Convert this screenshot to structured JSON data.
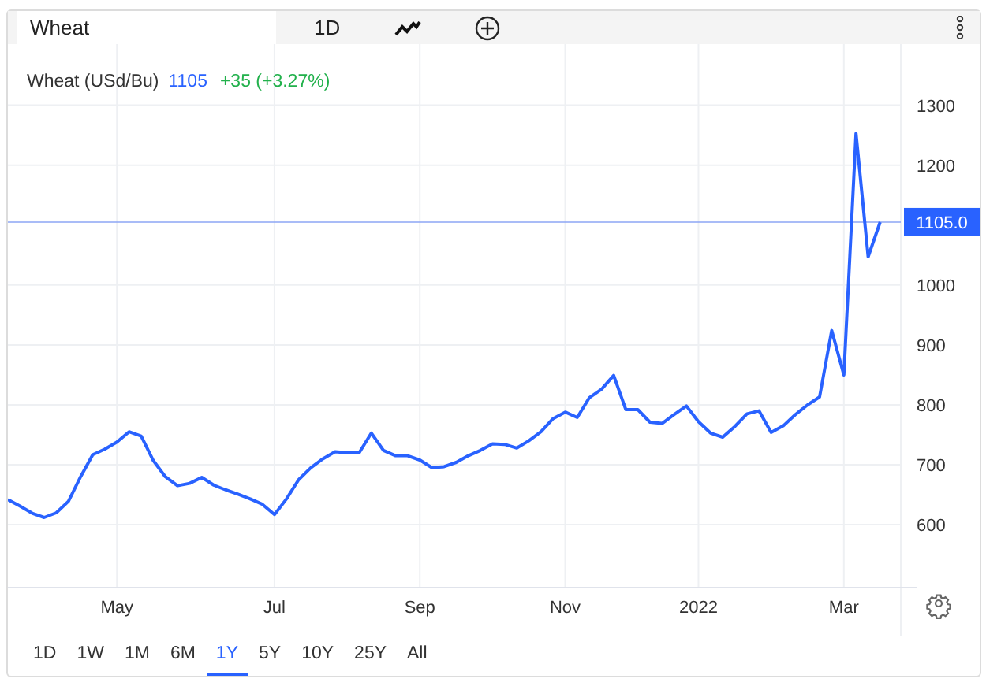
{
  "toolbar": {
    "search": {
      "value": "Wheat"
    },
    "interval": "1D"
  },
  "legend": {
    "name": "Wheat (USd/Bu)",
    "price": "1105",
    "change": "+35 (+3.27%)"
  },
  "chart": {
    "price_tag": "1105.0",
    "chart_data": {
      "type": "line",
      "grid": true,
      "ref_lines": [
        {
          "axis": "y",
          "value": 1105
        }
      ],
      "ylim": [
        495,
        1402
      ],
      "categories": [
        null,
        null,
        null,
        null,
        null,
        null,
        null,
        null,
        null,
        "May",
        null,
        null,
        null,
        null,
        null,
        null,
        null,
        null,
        null,
        null,
        null,
        null,
        "Jul",
        null,
        null,
        null,
        null,
        null,
        null,
        null,
        null,
        null,
        null,
        null,
        "Sep",
        null,
        null,
        null,
        null,
        null,
        null,
        null,
        null,
        null,
        null,
        null,
        "Nov",
        null,
        null,
        null,
        null,
        null,
        null,
        null,
        null,
        null,
        null,
        "2022",
        null,
        null,
        null,
        null,
        null,
        null,
        null,
        null,
        null,
        null,
        null,
        "Mar",
        null,
        null,
        null
      ],
      "yticks": [
        600,
        700,
        800,
        900,
        1000,
        1200,
        1300
      ],
      "series": [
        {
          "color": "#2962ff",
          "values": [
            642,
            631,
            619,
            612,
            620,
            639,
            680,
            717,
            726,
            738,
            755,
            748,
            707,
            680,
            665,
            669,
            679,
            666,
            658,
            651,
            643,
            634,
            617,
            643,
            675,
            695,
            710,
            722,
            720,
            720,
            753,
            724,
            715,
            715,
            708,
            695,
            697,
            704,
            715,
            724,
            735,
            734,
            728,
            740,
            755,
            777,
            788,
            779,
            812,
            826,
            849,
            792,
            792,
            771,
            769,
            784,
            798,
            772,
            753,
            746,
            764,
            785,
            790,
            754,
            765,
            784,
            800,
            813,
            924,
            850,
            1253,
            1047,
            1105
          ]
        }
      ]
    }
  },
  "ranges": [
    {
      "label": "1D",
      "selected": false
    },
    {
      "label": "1W",
      "selected": false
    },
    {
      "label": "1M",
      "selected": false
    },
    {
      "label": "6M",
      "selected": false
    },
    {
      "label": "1Y",
      "selected": true
    },
    {
      "label": "5Y",
      "selected": false
    },
    {
      "label": "10Y",
      "selected": false
    },
    {
      "label": "25Y",
      "selected": false
    },
    {
      "label": "All",
      "selected": false
    }
  ]
}
